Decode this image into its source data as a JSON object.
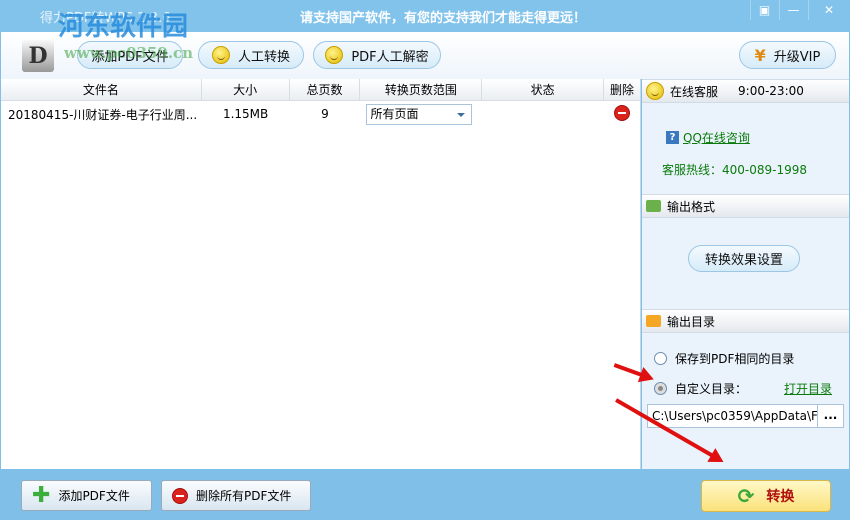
{
  "window": {
    "title": "得力PDF转WPS 2.3.6",
    "slogan": "请支持国产软件，有您的支持我们才能走得更远！",
    "menu_icon": "▣",
    "minimize": "—",
    "close": "✕"
  },
  "watermark": {
    "name": "河东软件园",
    "url": "www.pc0359.cn"
  },
  "toolbar": {
    "add_pdf": "添加PDF文件",
    "manual_convert": "人工转换",
    "pdf_decrypt": "PDF人工解密",
    "upgrade_vip": "升级VIP",
    "vip_icon": "¥"
  },
  "table": {
    "headers": [
      "文件名",
      "大小",
      "总页数",
      "转换页数范围",
      "状态",
      "删除"
    ],
    "rows": [
      {
        "name": "20180415-川财证券-电子行业周...",
        "size": "1.15MB",
        "pages": "9",
        "range": "所有页面",
        "status": ""
      }
    ]
  },
  "side": {
    "online_service": "在线客服",
    "hours": "9:00-23:00",
    "qq_link": "QQ在线咨询",
    "hotline": "客服热线：400-089-1998",
    "output_format": "输出格式",
    "effect_settings": "转换效果设置",
    "output_dir": "输出目录",
    "option_same": "保存到PDF相同的目录",
    "option_custom": "自定义目录：",
    "open_dir": "打开目录",
    "path": "C:\\Users\\pc0359\\AppData\\F",
    "browse": "..."
  },
  "bottom": {
    "add_pdf": "添加PDF文件",
    "delete_all": "删除所有PDF文件",
    "convert": "转换"
  },
  "colors": {
    "titlebar": "#82c3ec",
    "accent_green": "#0a7a0a",
    "convert_text": "#b01010"
  }
}
